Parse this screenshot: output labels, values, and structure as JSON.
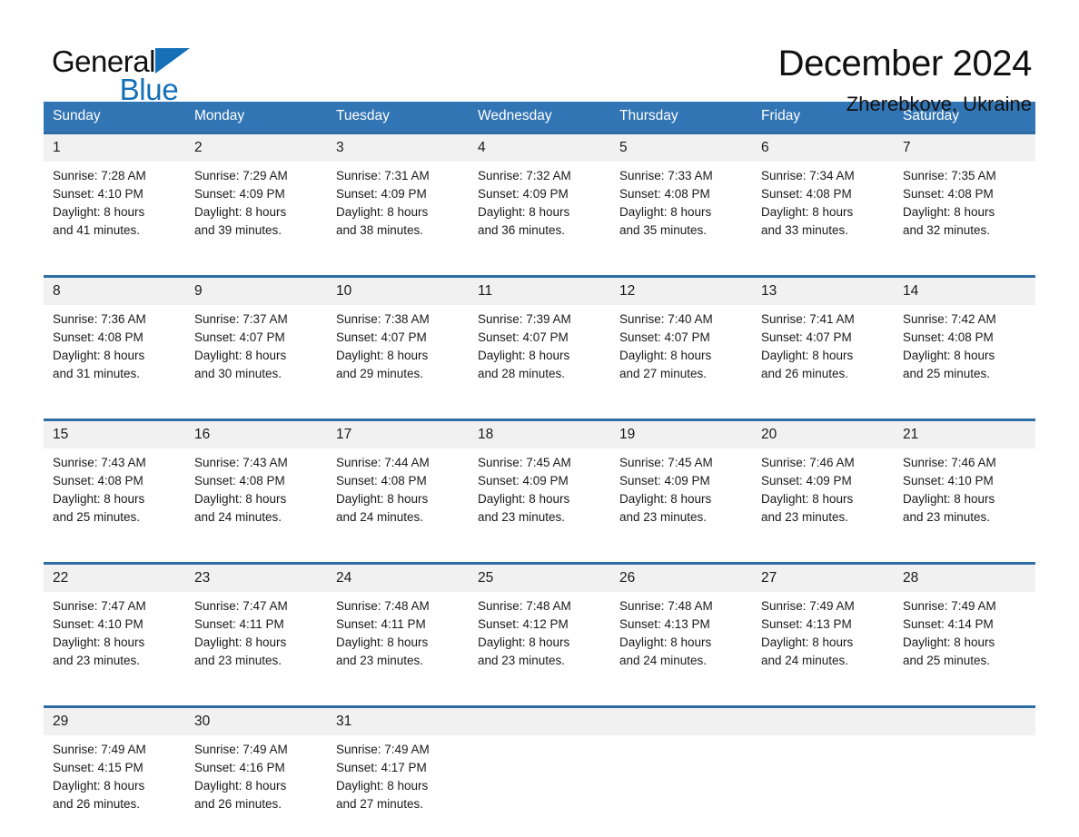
{
  "brand": {
    "name_part1": "General",
    "name_part2": "Blue",
    "triangle_color": "#1570b8"
  },
  "header": {
    "title": "December 2024",
    "subtitle": "Zherebkove, Ukraine"
  },
  "theme": {
    "header_blue": "#3275b4",
    "row_rule_blue": "#2e6da4",
    "daynum_background": "#f1f1f1"
  },
  "weekdays": [
    "Sunday",
    "Monday",
    "Tuesday",
    "Wednesday",
    "Thursday",
    "Friday",
    "Saturday"
  ],
  "weeks": [
    {
      "days": [
        {
          "num": "1",
          "sunrise": "Sunrise: 7:28 AM",
          "sunset": "Sunset: 4:10 PM",
          "daylight1": "Daylight: 8 hours",
          "daylight2": "and 41 minutes."
        },
        {
          "num": "2",
          "sunrise": "Sunrise: 7:29 AM",
          "sunset": "Sunset: 4:09 PM",
          "daylight1": "Daylight: 8 hours",
          "daylight2": "and 39 minutes."
        },
        {
          "num": "3",
          "sunrise": "Sunrise: 7:31 AM",
          "sunset": "Sunset: 4:09 PM",
          "daylight1": "Daylight: 8 hours",
          "daylight2": "and 38 minutes."
        },
        {
          "num": "4",
          "sunrise": "Sunrise: 7:32 AM",
          "sunset": "Sunset: 4:09 PM",
          "daylight1": "Daylight: 8 hours",
          "daylight2": "and 36 minutes."
        },
        {
          "num": "5",
          "sunrise": "Sunrise: 7:33 AM",
          "sunset": "Sunset: 4:08 PM",
          "daylight1": "Daylight: 8 hours",
          "daylight2": "and 35 minutes."
        },
        {
          "num": "6",
          "sunrise": "Sunrise: 7:34 AM",
          "sunset": "Sunset: 4:08 PM",
          "daylight1": "Daylight: 8 hours",
          "daylight2": "and 33 minutes."
        },
        {
          "num": "7",
          "sunrise": "Sunrise: 7:35 AM",
          "sunset": "Sunset: 4:08 PM",
          "daylight1": "Daylight: 8 hours",
          "daylight2": "and 32 minutes."
        }
      ]
    },
    {
      "days": [
        {
          "num": "8",
          "sunrise": "Sunrise: 7:36 AM",
          "sunset": "Sunset: 4:08 PM",
          "daylight1": "Daylight: 8 hours",
          "daylight2": "and 31 minutes."
        },
        {
          "num": "9",
          "sunrise": "Sunrise: 7:37 AM",
          "sunset": "Sunset: 4:07 PM",
          "daylight1": "Daylight: 8 hours",
          "daylight2": "and 30 minutes."
        },
        {
          "num": "10",
          "sunrise": "Sunrise: 7:38 AM",
          "sunset": "Sunset: 4:07 PM",
          "daylight1": "Daylight: 8 hours",
          "daylight2": "and 29 minutes."
        },
        {
          "num": "11",
          "sunrise": "Sunrise: 7:39 AM",
          "sunset": "Sunset: 4:07 PM",
          "daylight1": "Daylight: 8 hours",
          "daylight2": "and 28 minutes."
        },
        {
          "num": "12",
          "sunrise": "Sunrise: 7:40 AM",
          "sunset": "Sunset: 4:07 PM",
          "daylight1": "Daylight: 8 hours",
          "daylight2": "and 27 minutes."
        },
        {
          "num": "13",
          "sunrise": "Sunrise: 7:41 AM",
          "sunset": "Sunset: 4:07 PM",
          "daylight1": "Daylight: 8 hours",
          "daylight2": "and 26 minutes."
        },
        {
          "num": "14",
          "sunrise": "Sunrise: 7:42 AM",
          "sunset": "Sunset: 4:08 PM",
          "daylight1": "Daylight: 8 hours",
          "daylight2": "and 25 minutes."
        }
      ]
    },
    {
      "days": [
        {
          "num": "15",
          "sunrise": "Sunrise: 7:43 AM",
          "sunset": "Sunset: 4:08 PM",
          "daylight1": "Daylight: 8 hours",
          "daylight2": "and 25 minutes."
        },
        {
          "num": "16",
          "sunrise": "Sunrise: 7:43 AM",
          "sunset": "Sunset: 4:08 PM",
          "daylight1": "Daylight: 8 hours",
          "daylight2": "and 24 minutes."
        },
        {
          "num": "17",
          "sunrise": "Sunrise: 7:44 AM",
          "sunset": "Sunset: 4:08 PM",
          "daylight1": "Daylight: 8 hours",
          "daylight2": "and 24 minutes."
        },
        {
          "num": "18",
          "sunrise": "Sunrise: 7:45 AM",
          "sunset": "Sunset: 4:09 PM",
          "daylight1": "Daylight: 8 hours",
          "daylight2": "and 23 minutes."
        },
        {
          "num": "19",
          "sunrise": "Sunrise: 7:45 AM",
          "sunset": "Sunset: 4:09 PM",
          "daylight1": "Daylight: 8 hours",
          "daylight2": "and 23 minutes."
        },
        {
          "num": "20",
          "sunrise": "Sunrise: 7:46 AM",
          "sunset": "Sunset: 4:09 PM",
          "daylight1": "Daylight: 8 hours",
          "daylight2": "and 23 minutes."
        },
        {
          "num": "21",
          "sunrise": "Sunrise: 7:46 AM",
          "sunset": "Sunset: 4:10 PM",
          "daylight1": "Daylight: 8 hours",
          "daylight2": "and 23 minutes."
        }
      ]
    },
    {
      "days": [
        {
          "num": "22",
          "sunrise": "Sunrise: 7:47 AM",
          "sunset": "Sunset: 4:10 PM",
          "daylight1": "Daylight: 8 hours",
          "daylight2": "and 23 minutes."
        },
        {
          "num": "23",
          "sunrise": "Sunrise: 7:47 AM",
          "sunset": "Sunset: 4:11 PM",
          "daylight1": "Daylight: 8 hours",
          "daylight2": "and 23 minutes."
        },
        {
          "num": "24",
          "sunrise": "Sunrise: 7:48 AM",
          "sunset": "Sunset: 4:11 PM",
          "daylight1": "Daylight: 8 hours",
          "daylight2": "and 23 minutes."
        },
        {
          "num": "25",
          "sunrise": "Sunrise: 7:48 AM",
          "sunset": "Sunset: 4:12 PM",
          "daylight1": "Daylight: 8 hours",
          "daylight2": "and 23 minutes."
        },
        {
          "num": "26",
          "sunrise": "Sunrise: 7:48 AM",
          "sunset": "Sunset: 4:13 PM",
          "daylight1": "Daylight: 8 hours",
          "daylight2": "and 24 minutes."
        },
        {
          "num": "27",
          "sunrise": "Sunrise: 7:49 AM",
          "sunset": "Sunset: 4:13 PM",
          "daylight1": "Daylight: 8 hours",
          "daylight2": "and 24 minutes."
        },
        {
          "num": "28",
          "sunrise": "Sunrise: 7:49 AM",
          "sunset": "Sunset: 4:14 PM",
          "daylight1": "Daylight: 8 hours",
          "daylight2": "and 25 minutes."
        }
      ]
    },
    {
      "days": [
        {
          "num": "29",
          "sunrise": "Sunrise: 7:49 AM",
          "sunset": "Sunset: 4:15 PM",
          "daylight1": "Daylight: 8 hours",
          "daylight2": "and 26 minutes."
        },
        {
          "num": "30",
          "sunrise": "Sunrise: 7:49 AM",
          "sunset": "Sunset: 4:16 PM",
          "daylight1": "Daylight: 8 hours",
          "daylight2": "and 26 minutes."
        },
        {
          "num": "31",
          "sunrise": "Sunrise: 7:49 AM",
          "sunset": "Sunset: 4:17 PM",
          "daylight1": "Daylight: 8 hours",
          "daylight2": "and 27 minutes."
        },
        {
          "num": "",
          "sunrise": "",
          "sunset": "",
          "daylight1": "",
          "daylight2": ""
        },
        {
          "num": "",
          "sunrise": "",
          "sunset": "",
          "daylight1": "",
          "daylight2": ""
        },
        {
          "num": "",
          "sunrise": "",
          "sunset": "",
          "daylight1": "",
          "daylight2": ""
        },
        {
          "num": "",
          "sunrise": "",
          "sunset": "",
          "daylight1": "",
          "daylight2": ""
        }
      ]
    }
  ]
}
